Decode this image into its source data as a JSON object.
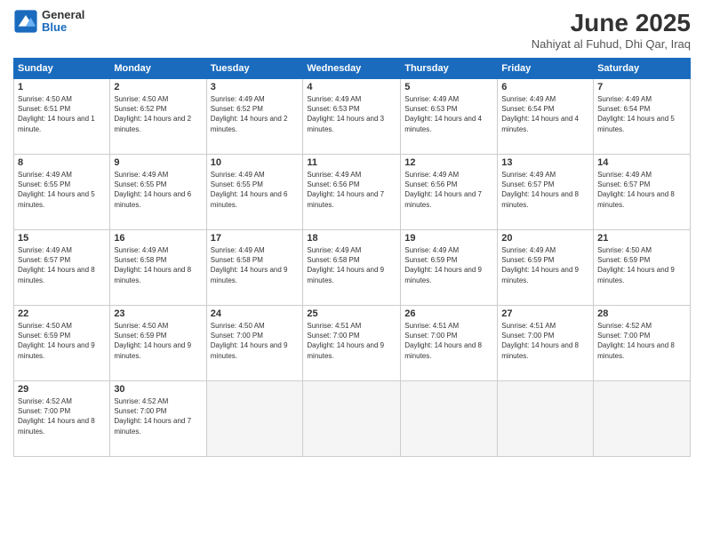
{
  "logo": {
    "general": "General",
    "blue": "Blue"
  },
  "title": "June 2025",
  "subtitle": "Nahiyat al Fuhud, Dhi Qar, Iraq",
  "headers": [
    "Sunday",
    "Monday",
    "Tuesday",
    "Wednesday",
    "Thursday",
    "Friday",
    "Saturday"
  ],
  "weeks": [
    [
      {
        "day": "1",
        "sunrise": "4:50 AM",
        "sunset": "6:51 PM",
        "daylight": "14 hours and 1 minute."
      },
      {
        "day": "2",
        "sunrise": "4:50 AM",
        "sunset": "6:52 PM",
        "daylight": "14 hours and 2 minutes."
      },
      {
        "day": "3",
        "sunrise": "4:49 AM",
        "sunset": "6:52 PM",
        "daylight": "14 hours and 2 minutes."
      },
      {
        "day": "4",
        "sunrise": "4:49 AM",
        "sunset": "6:53 PM",
        "daylight": "14 hours and 3 minutes."
      },
      {
        "day": "5",
        "sunrise": "4:49 AM",
        "sunset": "6:53 PM",
        "daylight": "14 hours and 4 minutes."
      },
      {
        "day": "6",
        "sunrise": "4:49 AM",
        "sunset": "6:54 PM",
        "daylight": "14 hours and 4 minutes."
      },
      {
        "day": "7",
        "sunrise": "4:49 AM",
        "sunset": "6:54 PM",
        "daylight": "14 hours and 5 minutes."
      }
    ],
    [
      {
        "day": "8",
        "sunrise": "4:49 AM",
        "sunset": "6:55 PM",
        "daylight": "14 hours and 5 minutes."
      },
      {
        "day": "9",
        "sunrise": "4:49 AM",
        "sunset": "6:55 PM",
        "daylight": "14 hours and 6 minutes."
      },
      {
        "day": "10",
        "sunrise": "4:49 AM",
        "sunset": "6:55 PM",
        "daylight": "14 hours and 6 minutes."
      },
      {
        "day": "11",
        "sunrise": "4:49 AM",
        "sunset": "6:56 PM",
        "daylight": "14 hours and 7 minutes."
      },
      {
        "day": "12",
        "sunrise": "4:49 AM",
        "sunset": "6:56 PM",
        "daylight": "14 hours and 7 minutes."
      },
      {
        "day": "13",
        "sunrise": "4:49 AM",
        "sunset": "6:57 PM",
        "daylight": "14 hours and 8 minutes."
      },
      {
        "day": "14",
        "sunrise": "4:49 AM",
        "sunset": "6:57 PM",
        "daylight": "14 hours and 8 minutes."
      }
    ],
    [
      {
        "day": "15",
        "sunrise": "4:49 AM",
        "sunset": "6:57 PM",
        "daylight": "14 hours and 8 minutes."
      },
      {
        "day": "16",
        "sunrise": "4:49 AM",
        "sunset": "6:58 PM",
        "daylight": "14 hours and 8 minutes."
      },
      {
        "day": "17",
        "sunrise": "4:49 AM",
        "sunset": "6:58 PM",
        "daylight": "14 hours and 9 minutes."
      },
      {
        "day": "18",
        "sunrise": "4:49 AM",
        "sunset": "6:58 PM",
        "daylight": "14 hours and 9 minutes."
      },
      {
        "day": "19",
        "sunrise": "4:49 AM",
        "sunset": "6:59 PM",
        "daylight": "14 hours and 9 minutes."
      },
      {
        "day": "20",
        "sunrise": "4:49 AM",
        "sunset": "6:59 PM",
        "daylight": "14 hours and 9 minutes."
      },
      {
        "day": "21",
        "sunrise": "4:50 AM",
        "sunset": "6:59 PM",
        "daylight": "14 hours and 9 minutes."
      }
    ],
    [
      {
        "day": "22",
        "sunrise": "4:50 AM",
        "sunset": "6:59 PM",
        "daylight": "14 hours and 9 minutes."
      },
      {
        "day": "23",
        "sunrise": "4:50 AM",
        "sunset": "6:59 PM",
        "daylight": "14 hours and 9 minutes."
      },
      {
        "day": "24",
        "sunrise": "4:50 AM",
        "sunset": "7:00 PM",
        "daylight": "14 hours and 9 minutes."
      },
      {
        "day": "25",
        "sunrise": "4:51 AM",
        "sunset": "7:00 PM",
        "daylight": "14 hours and 9 minutes."
      },
      {
        "day": "26",
        "sunrise": "4:51 AM",
        "sunset": "7:00 PM",
        "daylight": "14 hours and 8 minutes."
      },
      {
        "day": "27",
        "sunrise": "4:51 AM",
        "sunset": "7:00 PM",
        "daylight": "14 hours and 8 minutes."
      },
      {
        "day": "28",
        "sunrise": "4:52 AM",
        "sunset": "7:00 PM",
        "daylight": "14 hours and 8 minutes."
      }
    ],
    [
      {
        "day": "29",
        "sunrise": "4:52 AM",
        "sunset": "7:00 PM",
        "daylight": "14 hours and 8 minutes."
      },
      {
        "day": "30",
        "sunrise": "4:52 AM",
        "sunset": "7:00 PM",
        "daylight": "14 hours and 7 minutes."
      },
      null,
      null,
      null,
      null,
      null
    ]
  ],
  "labels": {
    "sunrise": "Sunrise:",
    "sunset": "Sunset:",
    "daylight": "Daylight:"
  }
}
